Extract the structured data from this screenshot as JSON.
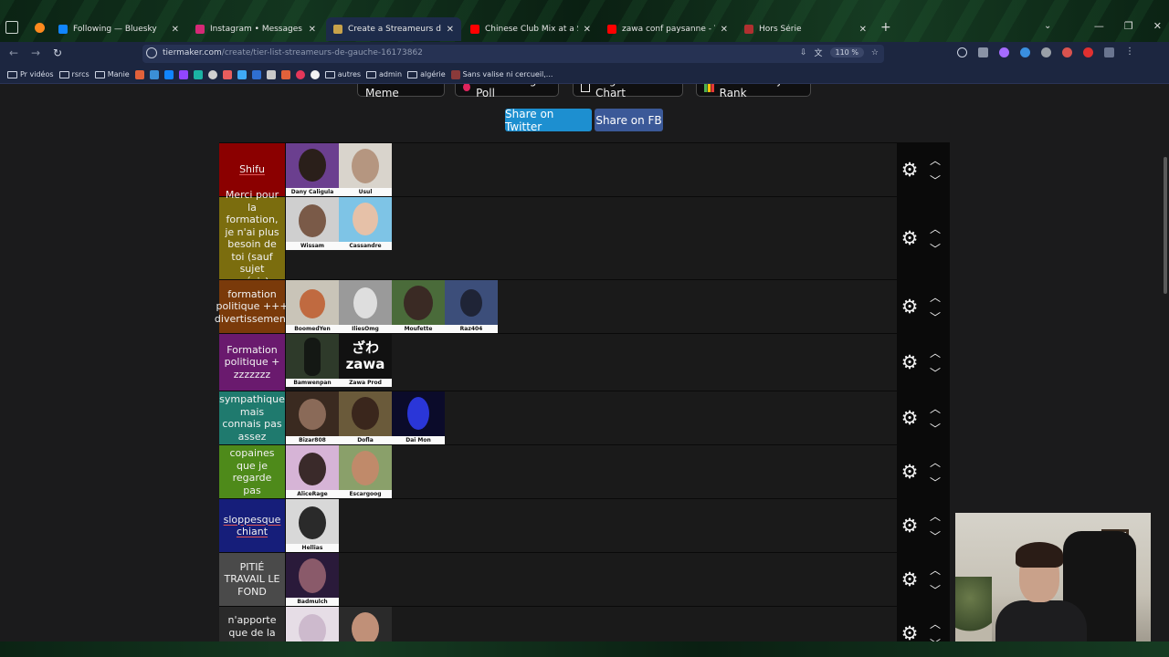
{
  "browser": {
    "tabs": [
      {
        "title": "Following — Bluesky",
        "active": false,
        "favicon_color": "#1185fe"
      },
      {
        "title": "Instagram • Messages",
        "active": false,
        "favicon_color": "#d62976"
      },
      {
        "title": "Create a Streameurs de Gauche",
        "active": true,
        "favicon_color": "#c8a24a"
      },
      {
        "title": "Chinese Club Mix at a Senior Ce",
        "active": false,
        "favicon_color": "#ff0000"
      },
      {
        "title": "zawa conf paysanne - YouTube",
        "active": false,
        "favicon_color": "#ff0000"
      },
      {
        "title": "Hors Série",
        "active": false,
        "favicon_color": "#b03030"
      }
    ],
    "url_host": "tiermaker.com",
    "url_path": "/create/tier-list-streameurs-de-gauche-16173862",
    "zoom": "110 %",
    "bookmarks": [
      {
        "label": "Pr vidéos",
        "type": "folder"
      },
      {
        "label": "rsrcs",
        "type": "folder"
      },
      {
        "label": "Manie",
        "type": "folder"
      },
      {
        "label": "autres",
        "type": "folder"
      },
      {
        "label": "admin",
        "type": "folder"
      },
      {
        "label": "algérie",
        "type": "folder"
      },
      {
        "label": "Sans valise ni cercueil,...",
        "type": "link"
      }
    ]
  },
  "page": {
    "top_buttons": [
      "Create a Meme",
      "Live Voting Poll",
      "Alignment Chart",
      "Community Rank"
    ],
    "share_twitter": "Share on Twitter",
    "share_fb": "Share on FB"
  },
  "tiers": [
    {
      "label": "Shifu",
      "color": "#8b0000",
      "underline": true,
      "items": [
        {
          "name": "Dany Caligula",
          "bg": "#6b3f8f"
        },
        {
          "name": "Usul",
          "bg": "#d9d4cc"
        }
      ]
    },
    {
      "label": "Merci pour la formation, je n'ai plus besoin de toi (sauf sujet précis)",
      "color": "#7b6d0e",
      "underline": false,
      "items": [
        {
          "name": "Wissam",
          "bg": "#cfcfcf"
        },
        {
          "name": "Cassandre",
          "bg": "#7ec4e6"
        }
      ]
    },
    {
      "label": "formation politique +++ divertissement",
      "color": "#7a3a0a",
      "underline": false,
      "items": [
        {
          "name": "BoomedYen",
          "bg": "#c9c4b8"
        },
        {
          "name": "IliesOmg",
          "bg": "#9a9a9a"
        },
        {
          "name": "Moufette",
          "bg": "#4a6b3a"
        },
        {
          "name": "Raz404",
          "bg": "#3c4e7a"
        }
      ]
    },
    {
      "label": "Formation politique + zzzzzzz",
      "color": "#6a1a6e",
      "underline": false,
      "items": [
        {
          "name": "Bamwenpan",
          "bg": "#2e3a2a"
        },
        {
          "name": "Zawa Prod",
          "bg": "#111111",
          "text": "ざわ zawa"
        }
      ]
    },
    {
      "label": "sympathique mais connais pas assez",
      "color": "#1f7a6e",
      "underline": false,
      "items": [
        {
          "name": "Bizar808",
          "bg": "#3a2a20"
        },
        {
          "name": "Dofla",
          "bg": "#6a5a3a"
        },
        {
          "name": "Dai Mon",
          "bg": "#0b0b2a"
        }
      ]
    },
    {
      "label": "copaines que je regarde pas",
      "color": "#4e8a1a",
      "underline": false,
      "items": [
        {
          "name": "AliceRage",
          "bg": "#d6b4d6"
        },
        {
          "name": "Escargoog",
          "bg": "#8aa06a"
        }
      ]
    },
    {
      "label": "sloppesque chiant",
      "color": "#161e7a",
      "underline": true,
      "items": [
        {
          "name": "Hellias",
          "bg": "#d8d8d8"
        }
      ]
    },
    {
      "label": "PITIÉ TRAVAIL LE FOND",
      "color": "#4a4a4a",
      "underline": false,
      "items": [
        {
          "name": "Badmulch",
          "bg": "#2a1a3a"
        }
      ]
    },
    {
      "label": "n'apporte que de la",
      "color": "#2a2a2a",
      "underline": false,
      "items": [
        {
          "name": "",
          "bg": "#e6dde6"
        },
        {
          "name": "",
          "bg": "#2a2a2a"
        }
      ]
    }
  ]
}
